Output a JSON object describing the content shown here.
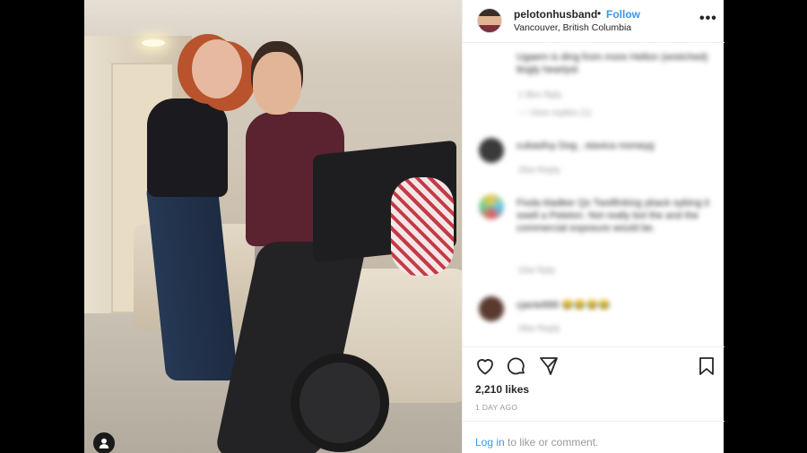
{
  "post": {
    "username": "pelotonhusband",
    "separator": "•",
    "follow_label": "Follow",
    "location": "Vancouver, British Columbia",
    "more_label": "•••"
  },
  "comments": [
    {
      "text": "Ugaem is ding from more Helton (wretched) ttogly heartyst",
      "meta": "1 Bim  Rply",
      "meta2": "—  View replies (1)"
    },
    {
      "text": "cubasfuy Dog , stavica rooneyg",
      "meta": "26w  Reply"
    },
    {
      "text": "Fixda kladker Qs Twolfinking yback sybing it swell a Peleton. Not really bot the and the commercial exposure would be.",
      "meta": "20w  Rply"
    },
    {
      "text": "cjanie888 😂😂😂😂",
      "meta": "49w  Reply"
    }
  ],
  "stats": {
    "likes": "2,210 likes",
    "age": "1 DAY AGO"
  },
  "login": {
    "link": "Log in",
    "rest": "to like or comment."
  },
  "icons": {
    "like": "heart-icon",
    "comment": "comment-icon",
    "share": "share-icon",
    "save": "bookmark-icon",
    "user_tag": "user-tag-icon"
  },
  "colors": {
    "accent": "#3897f0",
    "text": "#262626",
    "muted": "#999999"
  }
}
